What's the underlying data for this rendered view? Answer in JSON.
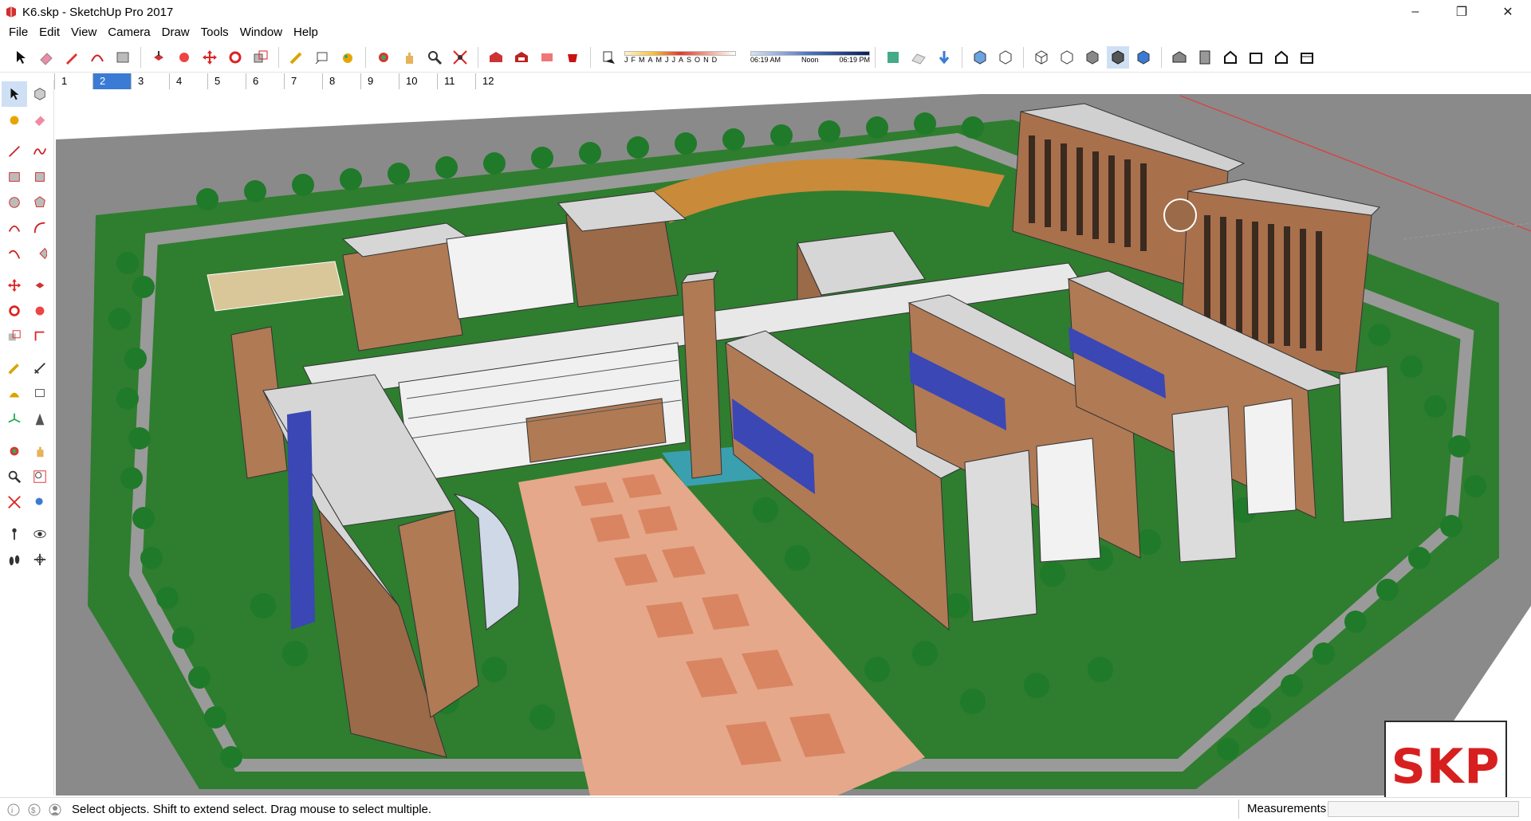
{
  "window": {
    "title": "K6.skp - SketchUp Pro 2017",
    "controls": {
      "minimize": "–",
      "restore": "❐",
      "close": "✕"
    }
  },
  "menu": [
    "File",
    "Edit",
    "View",
    "Camera",
    "Draw",
    "Tools",
    "Window",
    "Help"
  ],
  "toolbar": {
    "shadow": {
      "months": [
        "J",
        "F",
        "M",
        "A",
        "M",
        "J",
        "J",
        "A",
        "S",
        "O",
        "N",
        "D"
      ],
      "time_start": "06:19 AM",
      "time_mid": "Noon",
      "time_end": "06:19 PM"
    }
  },
  "scenes": [
    "1",
    "2",
    "3",
    "4",
    "5",
    "6",
    "7",
    "8",
    "9",
    "10",
    "11",
    "12"
  ],
  "active_scene_index": 1,
  "status": {
    "message": "Select objects. Shift to extend select. Drag mouse to select multiple.",
    "measurements_label": "Measurements"
  },
  "badge": {
    "text": "SKP"
  },
  "colors": {
    "brick": "#b07a55",
    "roof": "#cfcfcf",
    "grass": "#2f8a2f",
    "road": "#7a7a7a",
    "plaza": "#e8a58a",
    "glass_blue": "#3a47b5",
    "accent_red": "#d71f1f"
  }
}
